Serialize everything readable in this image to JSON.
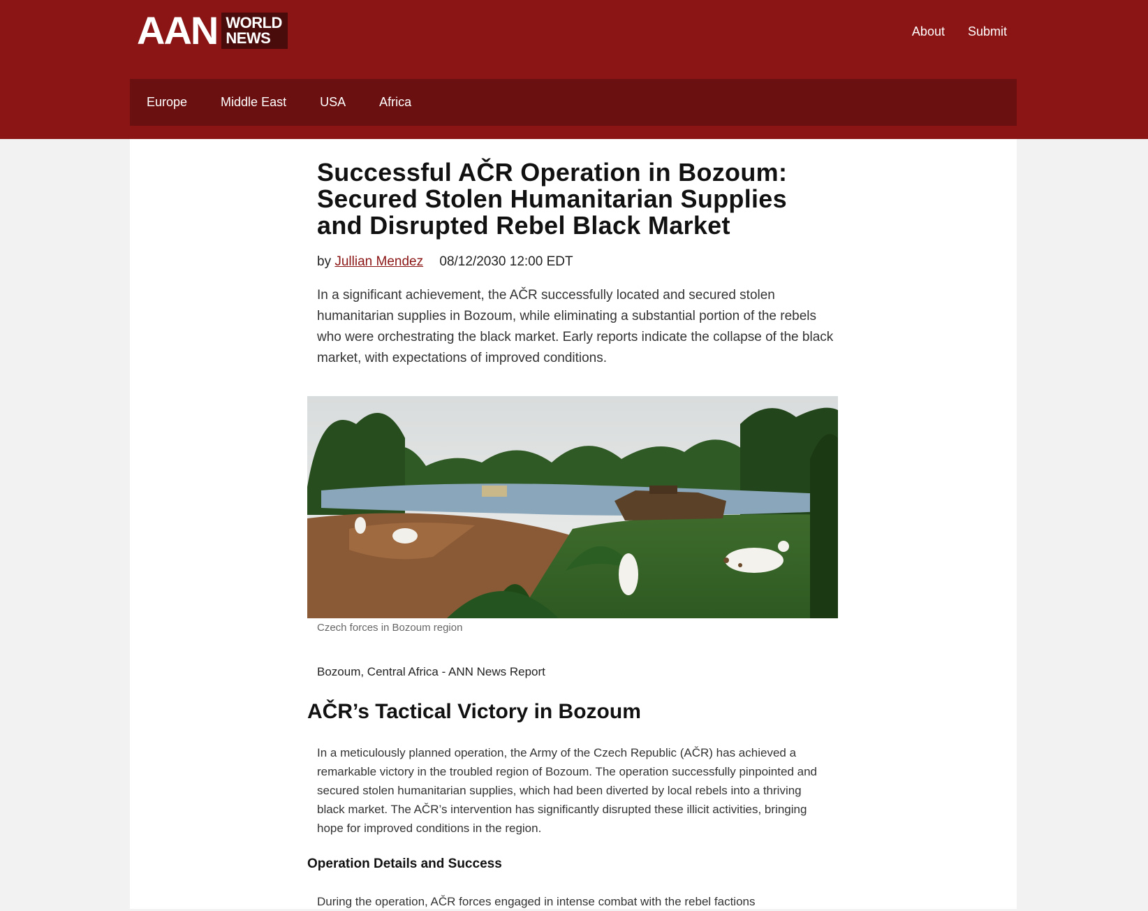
{
  "header": {
    "logo_main": "AAN",
    "logo_sub_line1": "WORLD",
    "logo_sub_line2": "NEWS",
    "links": [
      "About",
      "Submit"
    ]
  },
  "nav": {
    "items": [
      "Europe",
      "Middle East",
      "USA",
      "Africa"
    ]
  },
  "article": {
    "headline": "Successful AČR Operation in Bozoum: Secured Stolen Humanitarian Supplies and Disrupted Rebel Black Market",
    "byline_prefix": "by",
    "author": "Jullian Mendez",
    "date": "08/12/2030 12:00 EDT",
    "lead": "In a significant achievement, the AČR successfully located and secured stolen humanitarian supplies in Bozoum, while eliminating a substantial portion of the rebels who were orchestrating the black market. Early reports indicate the collapse of the black market, with expectations of improved conditions.",
    "image_caption": "Czech forces in Bozoum region",
    "dateline": "Bozoum, Central Africa - ANN News Report",
    "section1_title": "AČR’s Tactical Victory in Bozoum",
    "section1_text": "In a meticulously planned operation, the Army of the Czech Republic (AČR) has achieved a remarkable victory in the troubled region of Bozoum. The operation successfully pinpointed and secured stolen humanitarian supplies, which had been diverted by local rebels into a thriving black market. The AČR’s intervention has significantly disrupted these illicit activities, bringing hope for improved conditions in the region.",
    "subsection1_title": "Operation Details and Success",
    "subsection1_text": "During the operation, AČR forces engaged in intense combat with the rebel factions"
  },
  "colors": {
    "header_bg": "#8b1515",
    "nav_bg": "#6b1010",
    "logo_box_bg": "#4a0b0b",
    "author_link": "#8b1515",
    "page_bg": "#f2f2f2"
  }
}
